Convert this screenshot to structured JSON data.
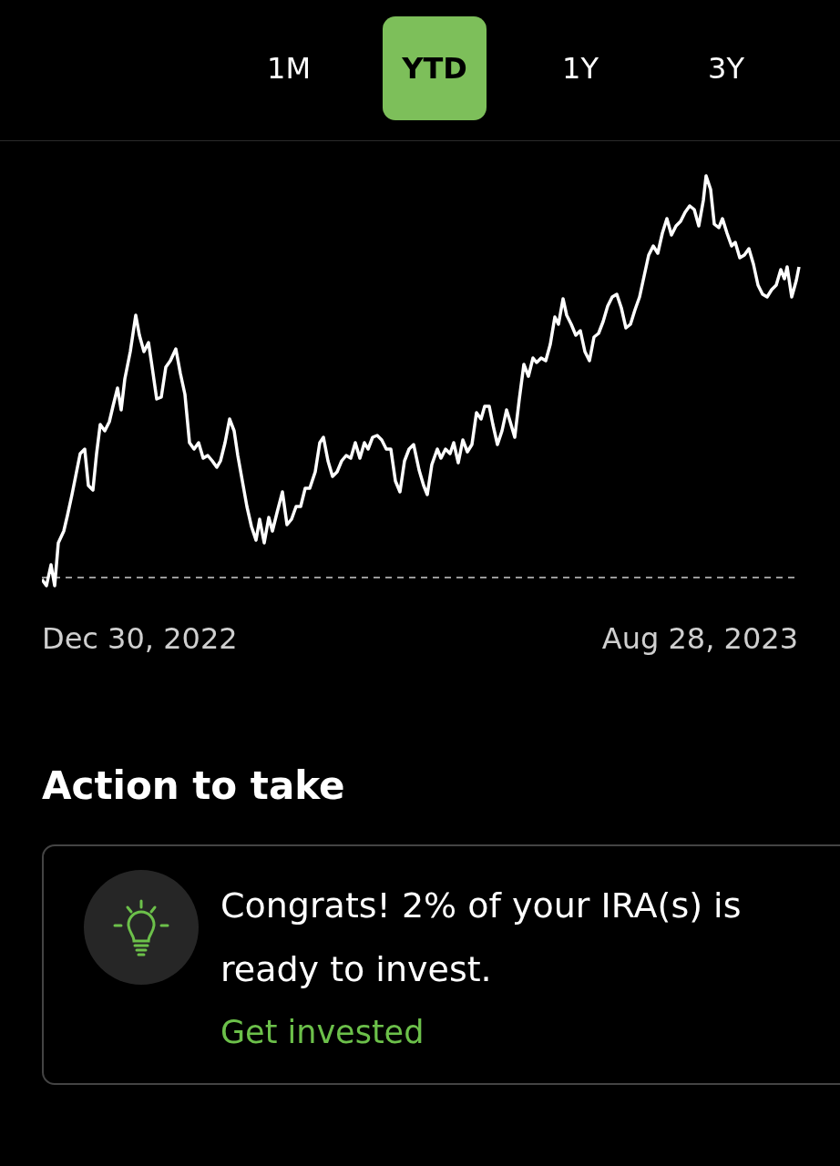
{
  "range_tabs": [
    {
      "label": "1M",
      "selected": false
    },
    {
      "label": "YTD",
      "selected": true
    },
    {
      "label": "1Y",
      "selected": false
    },
    {
      "label": "3Y",
      "selected": false
    }
  ],
  "chart": {
    "start_date": "Dec 30, 2022",
    "end_date": "Aug 28, 2023"
  },
  "action_section": {
    "title": "Action to take",
    "card": {
      "message": "Congrats! 2% of your IRA(s) is ready to invest.",
      "link": "Get invested"
    }
  }
}
